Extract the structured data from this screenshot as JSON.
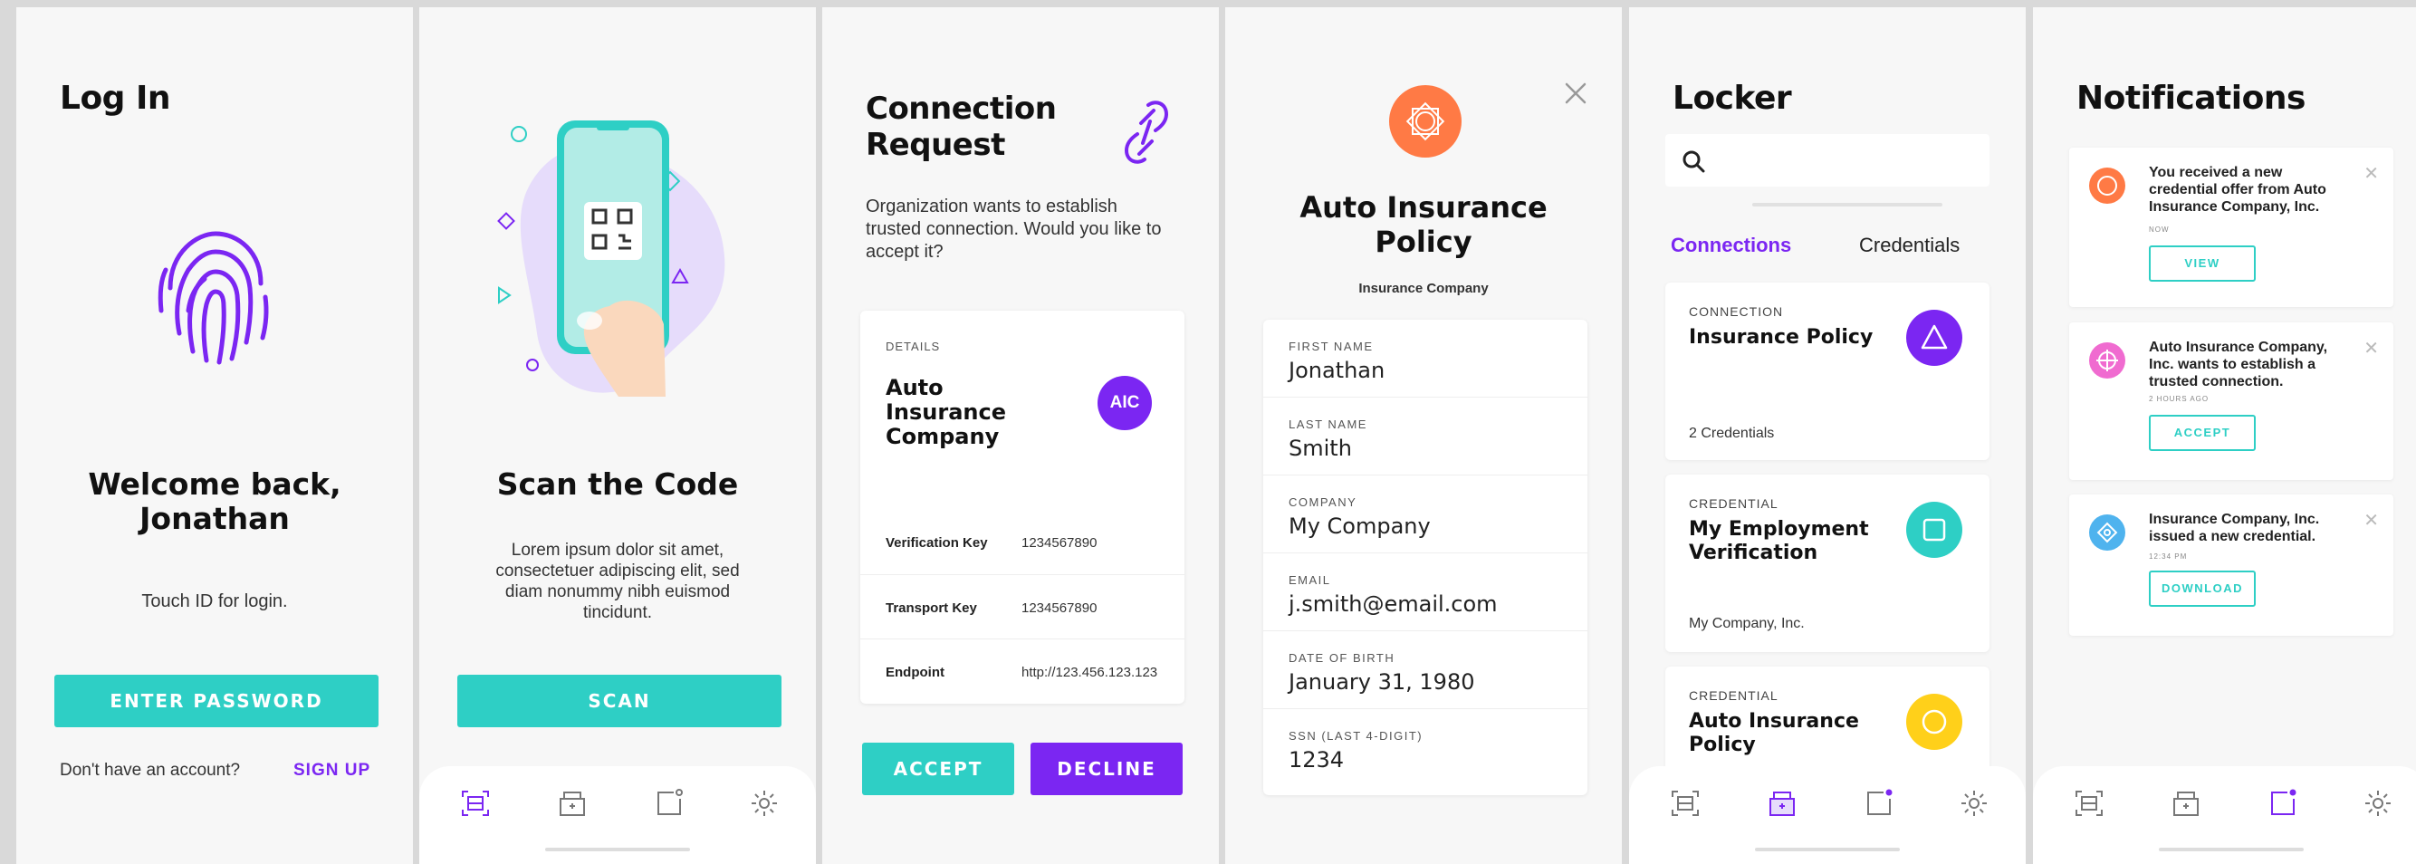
{
  "login": {
    "title": "Log In",
    "welcome": "Welcome back, Jonathan",
    "hint": "Touch ID for login.",
    "enter_password": "ENTER PASSWORD",
    "no_account": "Don't have an account?",
    "sign_up": "SIGN UP"
  },
  "scan": {
    "title": "Scan the Code",
    "body": "Lorem ipsum dolor sit amet, consectetuer adipiscing elit, sed diam nonummy nibh euismod tincidunt.",
    "scan_button": "SCAN"
  },
  "connection": {
    "title_line1": "Connection",
    "title_line2": "Request",
    "body": "Organization wants to establish trusted connection. Would you like to accept it?",
    "details_label": "DETAILS",
    "org_name": "Auto Insurance Company",
    "org_badge": "AIC",
    "rows": [
      {
        "key": "Verification Key",
        "value": "1234567890"
      },
      {
        "key": "Transport Key",
        "value": "1234567890"
      },
      {
        "key": "Endpoint",
        "value": "http://123.456.123.123"
      }
    ],
    "accept": "ACCEPT",
    "decline": "DECLINE"
  },
  "policy": {
    "title": "Auto Insurance Policy",
    "subtitle": "Insurance Company",
    "fields": [
      {
        "label": "FIRST NAME",
        "value": "Jonathan"
      },
      {
        "label": "LAST NAME",
        "value": "Smith"
      },
      {
        "label": "COMPANY",
        "value": "My Company"
      },
      {
        "label": "EMAIL",
        "value": "j.smith@email.com"
      },
      {
        "label": "DATE OF BIRTH",
        "value": "January 31, 1980"
      },
      {
        "label": "SSN (LAST 4-DIGIT)",
        "value": "1234"
      }
    ]
  },
  "locker": {
    "title": "Locker",
    "tabs": [
      "Connections",
      "Credentials"
    ],
    "cards": [
      {
        "type": "CONNECTION",
        "title": "Insurance Policy",
        "footer": "2 Credentials",
        "color": "#7b26f2"
      },
      {
        "type": "CREDENTIAL",
        "title": "My Employment Verification",
        "footer": "My Company, Inc.",
        "color": "#2ecfc5"
      },
      {
        "type": "CREDENTIAL",
        "title": "Auto Insurance Policy",
        "footer": "",
        "color": "#ffd01a"
      }
    ]
  },
  "notifications": {
    "title": "Notifications",
    "items": [
      {
        "text": "You received a new credential offer from Auto Insurance Company, Inc.",
        "time": "NOW",
        "button": "VIEW",
        "color": "#ff7a45"
      },
      {
        "text": "Auto Insurance Company, Inc. wants to establish a trusted connection.",
        "time": "2 HOURS AGO",
        "button": "ACCEPT",
        "color": "#f06bd0"
      },
      {
        "text": "Insurance Company, Inc. issued a new credential.",
        "time": "12:34 PM",
        "button": "DOWNLOAD",
        "color": "#4fb3ee"
      }
    ]
  },
  "colors": {
    "teal": "#2ecfc5",
    "purple": "#7b26f2",
    "orange": "#ff7a45"
  },
  "icons": [
    "fingerprint-icon",
    "scan-icon",
    "locker-icon",
    "notifications-icon",
    "settings-icon",
    "search-icon",
    "link-icon",
    "close-icon"
  ]
}
